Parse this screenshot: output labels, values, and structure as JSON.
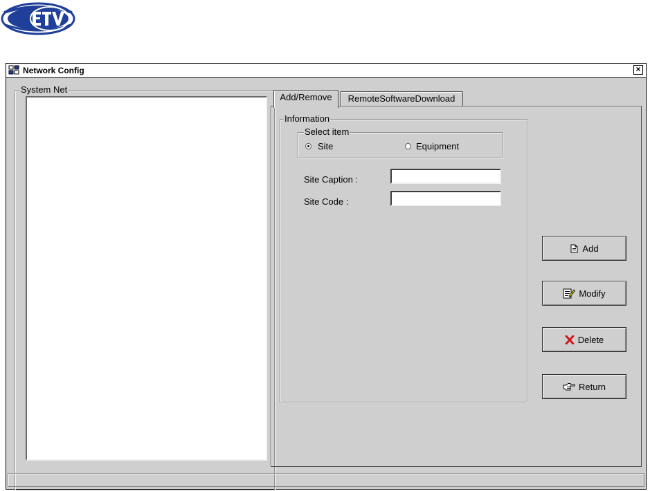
{
  "window": {
    "title": "Network Config",
    "close_glyph": "×"
  },
  "system_net": {
    "label": "System Net"
  },
  "tabs": [
    {
      "label": "Add/Remove",
      "active": true
    },
    {
      "label": "RemoteSoftwareDownload",
      "active": false
    }
  ],
  "information": {
    "label": "Information",
    "select_item": {
      "label": "Select item",
      "options": [
        {
          "label": "Site",
          "selected": true
        },
        {
          "label": "Equipment",
          "selected": false
        }
      ]
    },
    "site_caption": {
      "label": "Site Caption :",
      "value": ""
    },
    "site_code": {
      "label": "Site Code :",
      "value": ""
    }
  },
  "buttons": {
    "add": "Add",
    "modify": "Modify",
    "delete": "Delete",
    "return": "Return"
  },
  "colors": {
    "window_bg": "#cfcfcf",
    "logo_blue": "#1f3f99",
    "delete_red": "#d01818"
  },
  "icons": {
    "logo": "company-logo",
    "window": "window-icon",
    "add": "add-document-icon",
    "modify": "edit-document-icon",
    "delete": "delete-x-icon",
    "return": "pointing-hand-icon"
  }
}
